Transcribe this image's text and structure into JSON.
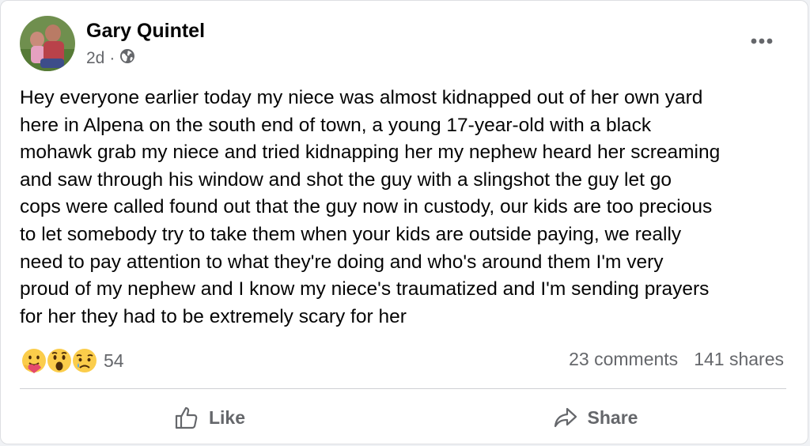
{
  "post": {
    "author": "Gary Quintel",
    "time": "2d",
    "separator": "·",
    "audience_icon": "globe-icon",
    "menu_icon": "more-horizontal-icon",
    "text": "Hey everyone earlier today my niece was almost kidnapped out of her own yard\nhere in Alpena on the south end of town, a young 17-year-old with a black\nmohawk grab my niece and tried kidnapping her my nephew heard her screaming\nand saw through his window and shot the guy with a slingshot the guy let go\ncops were called found out that the guy now in custody, our kids are too precious\nto let somebody try to take them when your kids are outside paying, we really\nneed to pay attention to what they're doing and who's around them I'm very\nproud of my nephew and I know my niece's traumatized and I'm sending prayers\nfor her they had to be extremely scary for her"
  },
  "engagement": {
    "reaction_icons": [
      "care-reaction-icon",
      "wow-reaction-icon",
      "sad-reaction-icon"
    ],
    "reaction_count": "54",
    "comments": "23 comments",
    "shares": "141 shares"
  },
  "actions": {
    "like_label": "Like",
    "like_icon": "thumbs-up-icon",
    "share_label": "Share",
    "share_icon": "share-arrow-icon"
  },
  "colors": {
    "text_primary": "#050505",
    "text_secondary": "#65676b",
    "divider": "#ced0d4",
    "reaction_yellow": "#fbcd4b",
    "card_background": "#ffffff"
  }
}
